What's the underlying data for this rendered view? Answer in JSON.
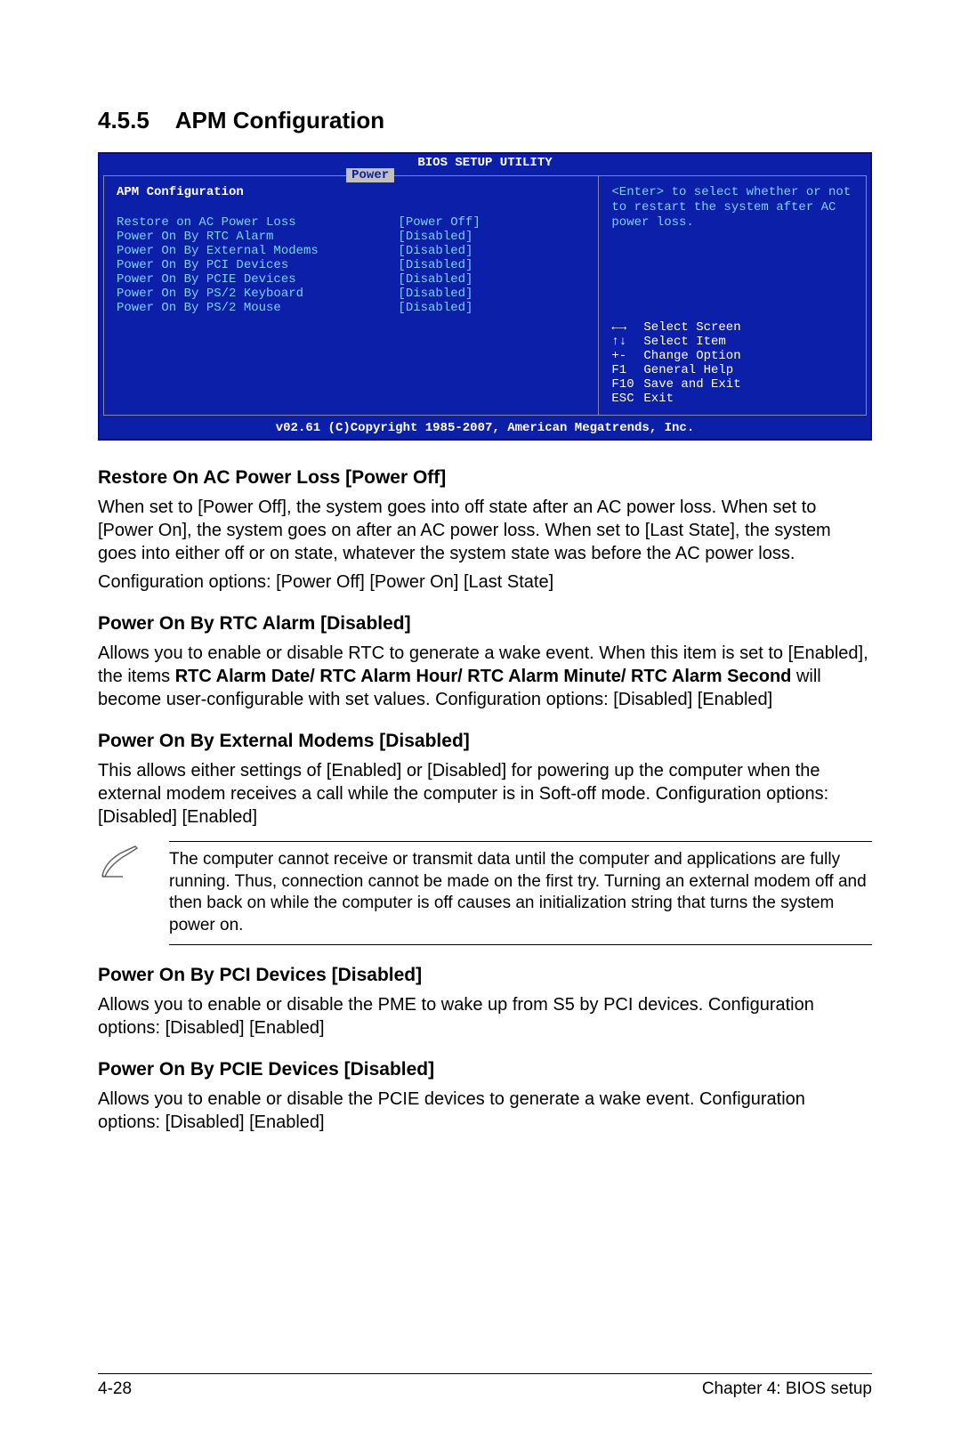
{
  "section_number": "4.5.5",
  "section_title": "APM Configuration",
  "bios": {
    "header": "BIOS SETUP UTILITY",
    "tab": "Power",
    "section_label": "APM Configuration",
    "items": [
      {
        "name": "Restore on AC Power Loss",
        "value": "[Power Off]"
      },
      {
        "name": "Power On By RTC Alarm",
        "value": "[Disabled]"
      },
      {
        "name": "Power On By External Modems",
        "value": "[Disabled]"
      },
      {
        "name": "Power On By PCI Devices",
        "value": "[Disabled]"
      },
      {
        "name": "Power On By PCIE Devices",
        "value": "[Disabled]"
      },
      {
        "name": "Power On By PS/2 Keyboard",
        "value": "[Disabled]"
      },
      {
        "name": "Power On By PS/2 Mouse",
        "value": "[Disabled]"
      }
    ],
    "help_text": "<Enter> to select whether or not to restart the system after AC power loss.",
    "keys": [
      {
        "key": "←→",
        "desc": "Select Screen"
      },
      {
        "key": "↑↓",
        "desc": "Select Item"
      },
      {
        "key": "+-",
        "desc": "Change Option"
      },
      {
        "key": "F1",
        "desc": "General Help"
      },
      {
        "key": "F10",
        "desc": "Save and Exit"
      },
      {
        "key": "ESC",
        "desc": "Exit"
      }
    ],
    "footer": "v02.61 (C)Copyright 1985-2007, American Megatrends, Inc."
  },
  "headings": {
    "h1": "Restore On AC Power Loss [Power Off]",
    "h2": "Power On By RTC Alarm [Disabled]",
    "h3": "Power On By External Modems [Disabled]",
    "h4": "Power On By PCI Devices [Disabled]",
    "h5": "Power On By PCIE Devices [Disabled]"
  },
  "paragraphs": {
    "p1": "When set to [Power Off], the system goes into off state after an AC power loss. When set to [Power On], the system goes on after an AC power loss. When set to [Last State], the system goes into either off or on state, whatever the system state was before the AC power loss.",
    "p1b": "Configuration options: [Power Off] [Power On] [Last State]",
    "p2a": "Allows you to enable or disable RTC to generate a wake event. When this item is set to [Enabled], the items ",
    "p2bold": "RTC Alarm Date/ RTC Alarm Hour/ RTC Alarm Minute/ RTC Alarm Second",
    "p2b": " will become user-configurable with set values. Configuration options: [Disabled] [Enabled]",
    "p3": "This allows either settings of [Enabled] or [Disabled] for powering up the computer when the external modem receives a call while the computer is in Soft-off mode. Configuration options: [Disabled] [Enabled]",
    "note": "The computer cannot receive or transmit data until the computer and applications are fully running. Thus, connection cannot be made on the first try. Turning an external modem off and then back on while the computer is off causes an initialization string that turns the system power on.",
    "p4": "Allows you to enable or disable the PME to wake up from S5 by PCI devices. Configuration options: [Disabled] [Enabled]",
    "p5": "Allows you to enable or disable the PCIE devices to generate a wake event. Configuration options: [Disabled] [Enabled]"
  },
  "footer": {
    "left": "4-28",
    "right": "Chapter 4: BIOS setup"
  }
}
